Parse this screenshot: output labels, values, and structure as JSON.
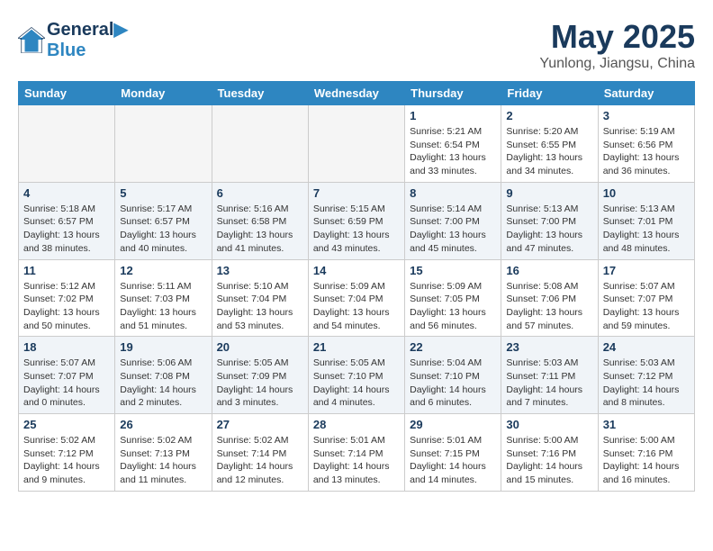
{
  "header": {
    "logo_line1": "General",
    "logo_line2": "Blue",
    "month_year": "May 2025",
    "location": "Yunlong, Jiangsu, China"
  },
  "days_of_week": [
    "Sunday",
    "Monday",
    "Tuesday",
    "Wednesday",
    "Thursday",
    "Friday",
    "Saturday"
  ],
  "weeks": [
    [
      {
        "day": "",
        "info": ""
      },
      {
        "day": "",
        "info": ""
      },
      {
        "day": "",
        "info": ""
      },
      {
        "day": "",
        "info": ""
      },
      {
        "day": "1",
        "info": "Sunrise: 5:21 AM\nSunset: 6:54 PM\nDaylight: 13 hours\nand 33 minutes."
      },
      {
        "day": "2",
        "info": "Sunrise: 5:20 AM\nSunset: 6:55 PM\nDaylight: 13 hours\nand 34 minutes."
      },
      {
        "day": "3",
        "info": "Sunrise: 5:19 AM\nSunset: 6:56 PM\nDaylight: 13 hours\nand 36 minutes."
      }
    ],
    [
      {
        "day": "4",
        "info": "Sunrise: 5:18 AM\nSunset: 6:57 PM\nDaylight: 13 hours\nand 38 minutes."
      },
      {
        "day": "5",
        "info": "Sunrise: 5:17 AM\nSunset: 6:57 PM\nDaylight: 13 hours\nand 40 minutes."
      },
      {
        "day": "6",
        "info": "Sunrise: 5:16 AM\nSunset: 6:58 PM\nDaylight: 13 hours\nand 41 minutes."
      },
      {
        "day": "7",
        "info": "Sunrise: 5:15 AM\nSunset: 6:59 PM\nDaylight: 13 hours\nand 43 minutes."
      },
      {
        "day": "8",
        "info": "Sunrise: 5:14 AM\nSunset: 7:00 PM\nDaylight: 13 hours\nand 45 minutes."
      },
      {
        "day": "9",
        "info": "Sunrise: 5:13 AM\nSunset: 7:00 PM\nDaylight: 13 hours\nand 47 minutes."
      },
      {
        "day": "10",
        "info": "Sunrise: 5:13 AM\nSunset: 7:01 PM\nDaylight: 13 hours\nand 48 minutes."
      }
    ],
    [
      {
        "day": "11",
        "info": "Sunrise: 5:12 AM\nSunset: 7:02 PM\nDaylight: 13 hours\nand 50 minutes."
      },
      {
        "day": "12",
        "info": "Sunrise: 5:11 AM\nSunset: 7:03 PM\nDaylight: 13 hours\nand 51 minutes."
      },
      {
        "day": "13",
        "info": "Sunrise: 5:10 AM\nSunset: 7:04 PM\nDaylight: 13 hours\nand 53 minutes."
      },
      {
        "day": "14",
        "info": "Sunrise: 5:09 AM\nSunset: 7:04 PM\nDaylight: 13 hours\nand 54 minutes."
      },
      {
        "day": "15",
        "info": "Sunrise: 5:09 AM\nSunset: 7:05 PM\nDaylight: 13 hours\nand 56 minutes."
      },
      {
        "day": "16",
        "info": "Sunrise: 5:08 AM\nSunset: 7:06 PM\nDaylight: 13 hours\nand 57 minutes."
      },
      {
        "day": "17",
        "info": "Sunrise: 5:07 AM\nSunset: 7:07 PM\nDaylight: 13 hours\nand 59 minutes."
      }
    ],
    [
      {
        "day": "18",
        "info": "Sunrise: 5:07 AM\nSunset: 7:07 PM\nDaylight: 14 hours\nand 0 minutes."
      },
      {
        "day": "19",
        "info": "Sunrise: 5:06 AM\nSunset: 7:08 PM\nDaylight: 14 hours\nand 2 minutes."
      },
      {
        "day": "20",
        "info": "Sunrise: 5:05 AM\nSunset: 7:09 PM\nDaylight: 14 hours\nand 3 minutes."
      },
      {
        "day": "21",
        "info": "Sunrise: 5:05 AM\nSunset: 7:10 PM\nDaylight: 14 hours\nand 4 minutes."
      },
      {
        "day": "22",
        "info": "Sunrise: 5:04 AM\nSunset: 7:10 PM\nDaylight: 14 hours\nand 6 minutes."
      },
      {
        "day": "23",
        "info": "Sunrise: 5:03 AM\nSunset: 7:11 PM\nDaylight: 14 hours\nand 7 minutes."
      },
      {
        "day": "24",
        "info": "Sunrise: 5:03 AM\nSunset: 7:12 PM\nDaylight: 14 hours\nand 8 minutes."
      }
    ],
    [
      {
        "day": "25",
        "info": "Sunrise: 5:02 AM\nSunset: 7:12 PM\nDaylight: 14 hours\nand 9 minutes."
      },
      {
        "day": "26",
        "info": "Sunrise: 5:02 AM\nSunset: 7:13 PM\nDaylight: 14 hours\nand 11 minutes."
      },
      {
        "day": "27",
        "info": "Sunrise: 5:02 AM\nSunset: 7:14 PM\nDaylight: 14 hours\nand 12 minutes."
      },
      {
        "day": "28",
        "info": "Sunrise: 5:01 AM\nSunset: 7:14 PM\nDaylight: 14 hours\nand 13 minutes."
      },
      {
        "day": "29",
        "info": "Sunrise: 5:01 AM\nSunset: 7:15 PM\nDaylight: 14 hours\nand 14 minutes."
      },
      {
        "day": "30",
        "info": "Sunrise: 5:00 AM\nSunset: 7:16 PM\nDaylight: 14 hours\nand 15 minutes."
      },
      {
        "day": "31",
        "info": "Sunrise: 5:00 AM\nSunset: 7:16 PM\nDaylight: 14 hours\nand 16 minutes."
      }
    ]
  ]
}
